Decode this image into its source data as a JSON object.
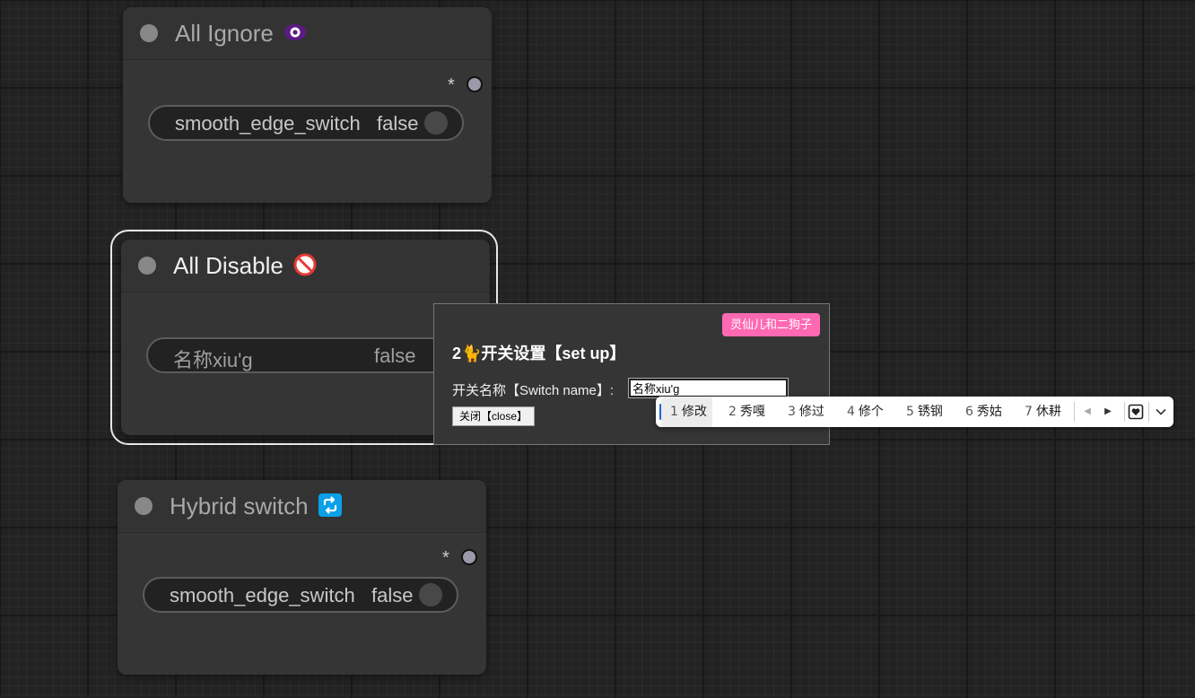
{
  "nodes": {
    "ignore": {
      "title": "All Ignore",
      "output_label": "*",
      "widget": {
        "label": "smooth_edge_switch",
        "value": "false"
      }
    },
    "disable": {
      "title": "All Disable",
      "widget": {
        "label": "名称xiu'g",
        "value": "false"
      }
    },
    "hybrid": {
      "title": "Hybrid switch",
      "output_label": "*",
      "widget": {
        "label": "smooth_edge_switch",
        "value": "false"
      }
    }
  },
  "dialog": {
    "author_badge": "灵仙儿和二狗子",
    "title": "2🐈开关设置【set up】",
    "name_label": "开关名称【Switch name】:",
    "name_value": "名称xiu'g",
    "close_label": "关闭【close】"
  },
  "ime": {
    "candidates": [
      {
        "num": "1",
        "text": "修改"
      },
      {
        "num": "2",
        "text": "秀嘎"
      },
      {
        "num": "3",
        "text": "修过"
      },
      {
        "num": "4",
        "text": "修个"
      },
      {
        "num": "5",
        "text": "锈钢"
      },
      {
        "num": "6",
        "text": "秀姑"
      },
      {
        "num": "7",
        "text": "休耕"
      }
    ],
    "prev_glyph": "◀",
    "next_glyph": "▶",
    "expand_glyph": "⌄"
  },
  "colors": {
    "accent_badge": "#ff69b4",
    "ignore_icon": "#6a1b9a",
    "disable_icon": "#e53935",
    "hybrid_icon": "#0aa0e8"
  },
  "icons": [
    "eye-icon",
    "prohibited-icon",
    "repeat-icon",
    "heart-box-icon",
    "chevron-down-icon"
  ]
}
